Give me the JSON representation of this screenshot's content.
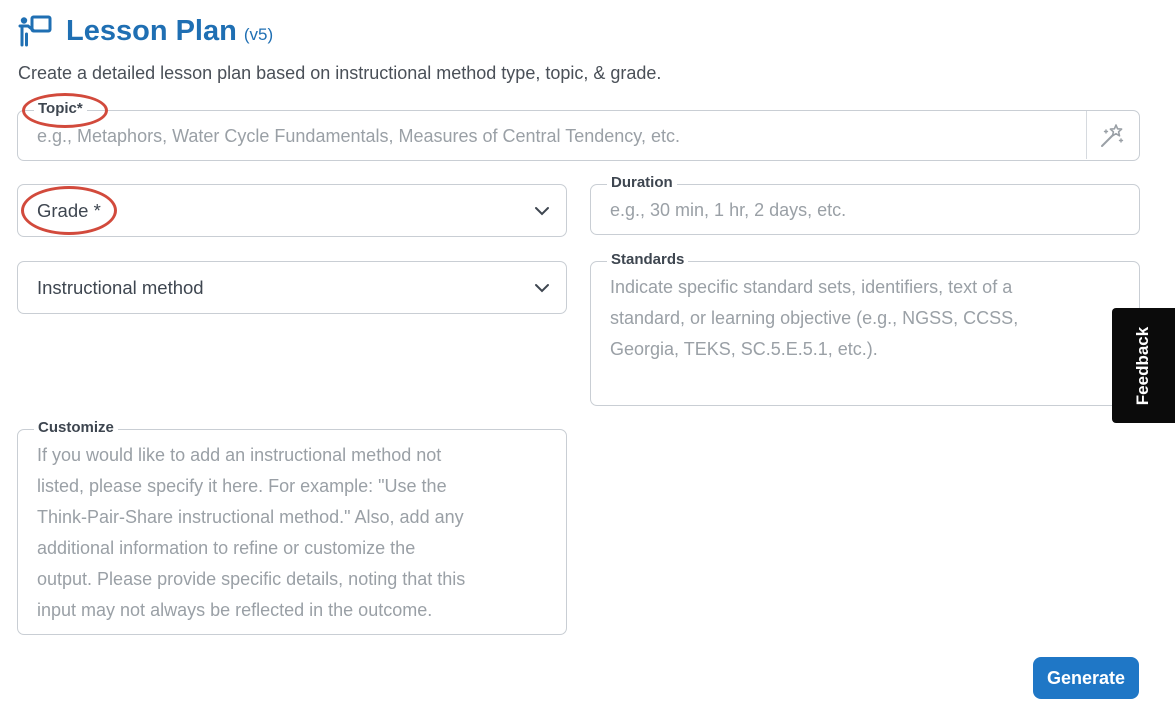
{
  "header": {
    "title": "Lesson Plan",
    "version": "(v5)",
    "description": "Create a detailed lesson plan based on instructional method type, topic, & grade.",
    "icon": "teacher-board-icon"
  },
  "form": {
    "topic": {
      "label": "Topic",
      "required_mark": "*",
      "placeholder": "e.g., Metaphors, Water Cycle Fundamentals, Measures of Central Tendency, etc.",
      "icon": "magic-wand-icon"
    },
    "grade": {
      "label": "Grade",
      "required_mark": "*"
    },
    "duration": {
      "label": "Duration",
      "placeholder": "e.g., 30 min, 1 hr, 2 days, etc."
    },
    "instructional_method": {
      "label": "Instructional method"
    },
    "standards": {
      "label": "Standards",
      "placeholder_lines": [
        "Indicate specific standard sets, identifiers, text of a",
        "standard, or learning objective (e.g., NGSS, CCSS,",
        "Georgia, TEKS, SC.5.E.5.1, etc.)."
      ]
    },
    "customize": {
      "label": "Customize",
      "placeholder_lines": [
        "If you would like to add an instructional method not",
        "listed, please specify it here. For example: \"Use the",
        "Think-Pair-Share instructional method.\" Also, add any",
        "additional information to refine or customize the",
        "output. Please provide specific details, noting that this",
        "input may not always be reflected in the outcome."
      ]
    }
  },
  "feedback": {
    "label": "Feedback"
  },
  "actions": {
    "generate_label": "Generate"
  },
  "colors": {
    "primary": "#1f6fb3",
    "button": "#1f77c6",
    "annotation": "#d24a3c",
    "feedback_bg": "#0b0b0b"
  }
}
